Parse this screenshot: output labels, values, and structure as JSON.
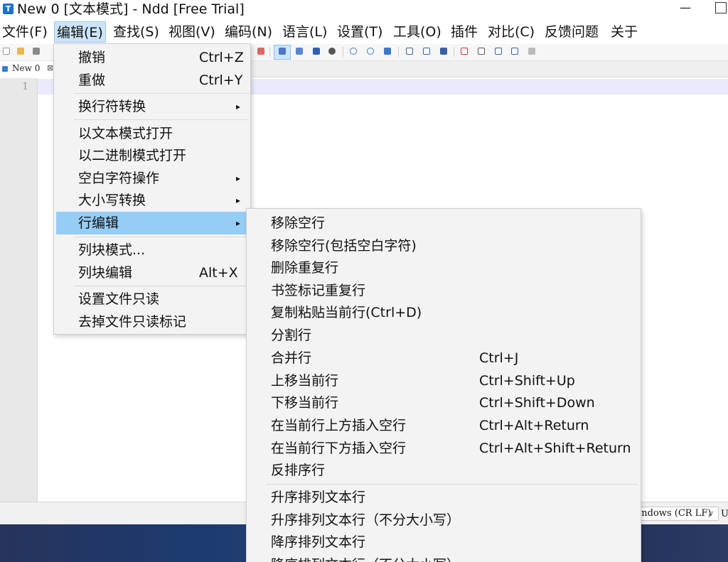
{
  "window": {
    "app_icon": "T",
    "title": "New 0 [文本模式] - Ndd [Free Trial]",
    "minimize": "—"
  },
  "menubar": [
    "文件(F)",
    "编辑(E)",
    "查找(S)",
    "视图(V)",
    "编码(N)",
    "语言(L)",
    "设置(T)",
    "工具(O)",
    "插件",
    "对比(C)",
    "反馈问题",
    "关于"
  ],
  "tab": {
    "label": "New 0",
    "close": "⊠"
  },
  "editor": {
    "line_number": "1"
  },
  "statusbar": {
    "eol": "Windows (CR LF)",
    "arrow": "∨",
    "tail": "U"
  },
  "edit_menu": {
    "items": [
      {
        "label": "撤销",
        "shortcut": "Ctrl+Z"
      },
      {
        "label": "重做",
        "shortcut": "Ctrl+Y"
      },
      {
        "label": "换行符转换",
        "arrow": "▸"
      },
      {
        "label": "以文本模式打开"
      },
      {
        "label": "以二进制模式打开"
      },
      {
        "label": "空白字符操作",
        "arrow": "▸"
      },
      {
        "label": "大小写转换",
        "arrow": "▸"
      },
      {
        "label": "行编辑",
        "arrow": "▸"
      },
      {
        "label": "列块模式..."
      },
      {
        "label": "列块编辑",
        "shortcut": "Alt+X"
      },
      {
        "label": "设置文件只读"
      },
      {
        "label": "去掉文件只读标记"
      }
    ]
  },
  "line_edit_menu": {
    "items": [
      {
        "label": "移除空行"
      },
      {
        "label": "移除空行(包括空白字符)"
      },
      {
        "label": "删除重复行"
      },
      {
        "label": "书签标记重复行"
      },
      {
        "label": "复制粘贴当前行(Ctrl+D)"
      },
      {
        "label": "分割行"
      },
      {
        "label": "合并行",
        "shortcut": "Ctrl+J"
      },
      {
        "label": "上移当前行",
        "shortcut": "Ctrl+Shift+Up"
      },
      {
        "label": "下移当前行",
        "shortcut": "Ctrl+Shift+Down"
      },
      {
        "label": "在当前行上方插入空行",
        "shortcut": "Ctrl+Alt+Return"
      },
      {
        "label": "在当前行下方插入空行",
        "shortcut": "Ctrl+Alt+Shift+Return"
      },
      {
        "label": "反排序行"
      },
      {
        "label": "升序排列文本行"
      },
      {
        "label": "升序排列文本行（不分大小写）"
      },
      {
        "label": "降序排列文本行"
      },
      {
        "label": "降序排列文本行（不分大小写）"
      }
    ]
  }
}
